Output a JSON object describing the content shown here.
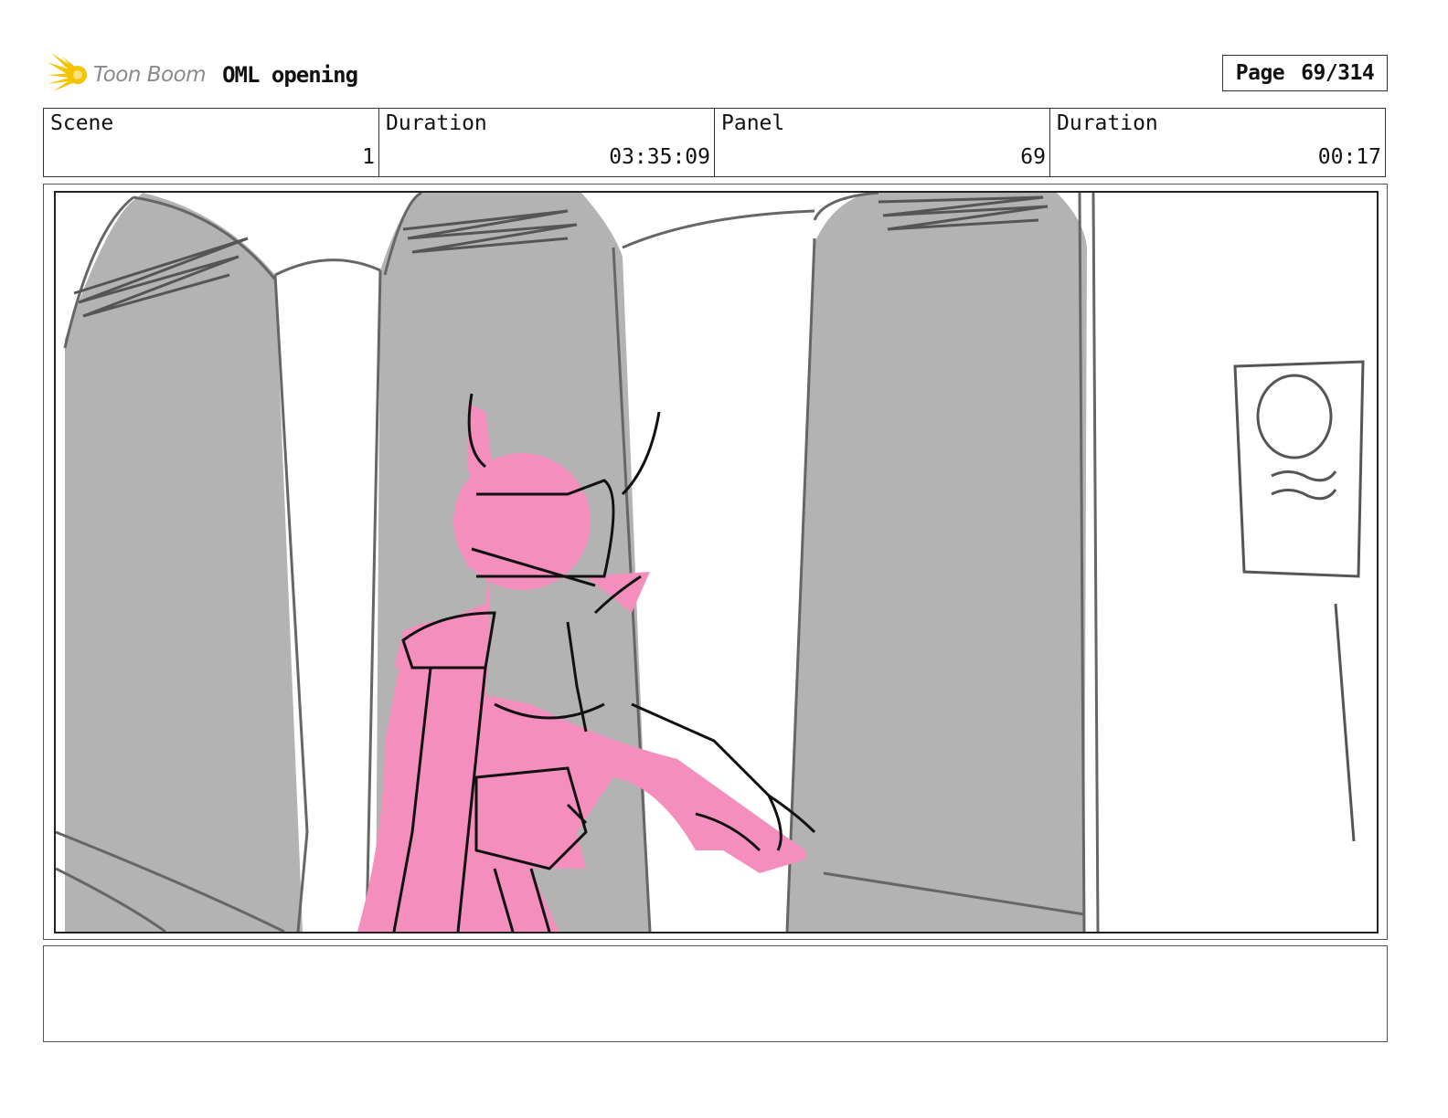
{
  "header": {
    "logo_text": "Toon Boom",
    "project_title": "OML opening",
    "page_label": "Page",
    "page_number": "69/314"
  },
  "info": {
    "scene_label": "Scene",
    "scene_value": "1",
    "scene_duration_label": "Duration",
    "scene_duration_value": "03:35:09",
    "panel_label": "Panel",
    "panel_value": "69",
    "panel_duration_label": "Duration",
    "panel_duration_value": "00:17"
  },
  "notes": {
    "text": ""
  },
  "colors": {
    "character_pink": "#f48fbd",
    "arch_gray": "#b3b3b3",
    "line_dark": "#222222",
    "line_gray": "#666666",
    "logo_yellow": "#f5c400"
  },
  "icons": {
    "logo": "starburst-icon"
  }
}
